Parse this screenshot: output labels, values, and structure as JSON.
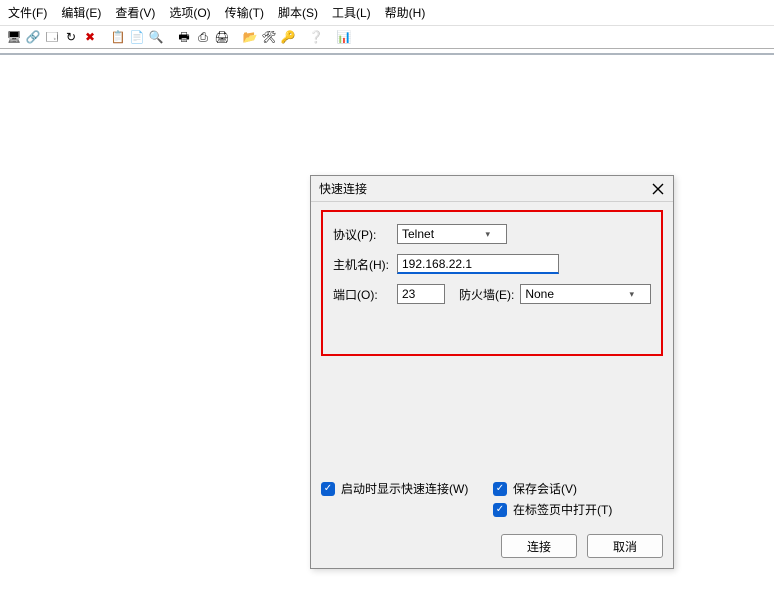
{
  "menubar": [
    "文件(F)",
    "编辑(E)",
    "查看(V)",
    "选项(O)",
    "传输(T)",
    "脚本(S)",
    "工具(L)",
    "帮助(H)"
  ],
  "toolbar_icons": [
    {
      "name": "session-icon",
      "glyph": "🖥"
    },
    {
      "name": "quick-connect-icon",
      "glyph": "🔗"
    },
    {
      "name": "window-icon",
      "glyph": "🗔"
    },
    {
      "name": "reconnect-icon",
      "glyph": "↻"
    },
    {
      "name": "cross-icon",
      "glyph": "✖",
      "color": "#c00"
    },
    {
      "name": "sep"
    },
    {
      "name": "copy-icon",
      "glyph": "📋"
    },
    {
      "name": "paste-icon",
      "glyph": "📄"
    },
    {
      "name": "find-icon",
      "glyph": "🔍"
    },
    {
      "name": "sep"
    },
    {
      "name": "print-icon",
      "glyph": "🖶"
    },
    {
      "name": "print-setup-icon",
      "glyph": "⎙"
    },
    {
      "name": "printer-icon",
      "glyph": "🖨"
    },
    {
      "name": "sep"
    },
    {
      "name": "folder-icon",
      "glyph": "📂"
    },
    {
      "name": "tools-icon",
      "glyph": "🛠"
    },
    {
      "name": "key-icon",
      "glyph": "🔑",
      "color": "#c9a400"
    },
    {
      "name": "sep"
    },
    {
      "name": "help-icon",
      "glyph": "❔",
      "color": "#2a6fd6"
    },
    {
      "name": "sep"
    },
    {
      "name": "chart-icon",
      "glyph": "📊"
    }
  ],
  "dialog": {
    "title": "快速连接",
    "labels": {
      "protocol": "协议(P):",
      "hostname": "主机名(H):",
      "port": "端口(O):",
      "firewall": "防火墙(E):"
    },
    "values": {
      "protocol": "Telnet",
      "hostname": "192.168.22.1",
      "port": "23",
      "firewall": "None"
    },
    "checks": {
      "show_quick": "启动时显示快速连接(W)",
      "save_session": "保存会话(V)",
      "open_in_tab": "在标签页中打开(T)"
    },
    "buttons": {
      "connect": "连接",
      "cancel": "取消"
    }
  }
}
